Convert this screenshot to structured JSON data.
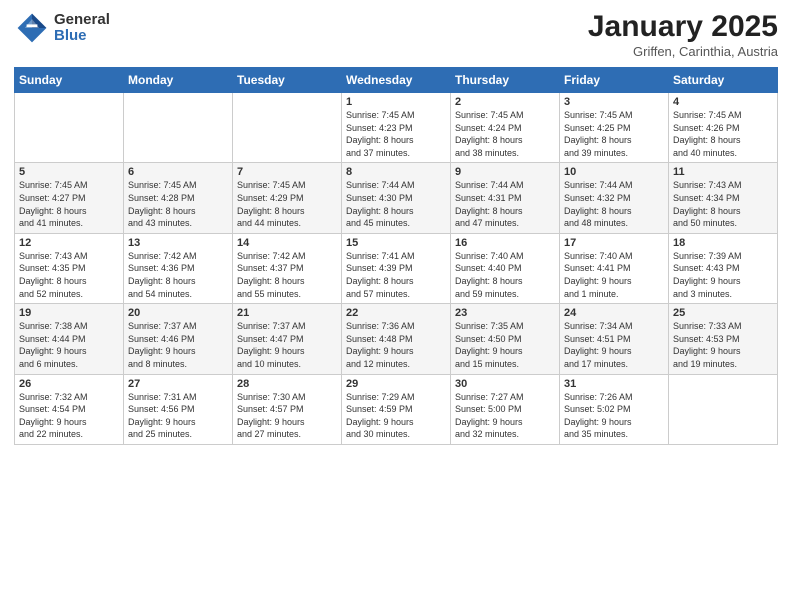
{
  "logo": {
    "general": "General",
    "blue": "Blue"
  },
  "title": "January 2025",
  "subtitle": "Griffen, Carinthia, Austria",
  "days": [
    "Sunday",
    "Monday",
    "Tuesday",
    "Wednesday",
    "Thursday",
    "Friday",
    "Saturday"
  ],
  "weeks": [
    [
      {
        "num": "",
        "info": ""
      },
      {
        "num": "",
        "info": ""
      },
      {
        "num": "",
        "info": ""
      },
      {
        "num": "1",
        "info": "Sunrise: 7:45 AM\nSunset: 4:23 PM\nDaylight: 8 hours\nand 37 minutes."
      },
      {
        "num": "2",
        "info": "Sunrise: 7:45 AM\nSunset: 4:24 PM\nDaylight: 8 hours\nand 38 minutes."
      },
      {
        "num": "3",
        "info": "Sunrise: 7:45 AM\nSunset: 4:25 PM\nDaylight: 8 hours\nand 39 minutes."
      },
      {
        "num": "4",
        "info": "Sunrise: 7:45 AM\nSunset: 4:26 PM\nDaylight: 8 hours\nand 40 minutes."
      }
    ],
    [
      {
        "num": "5",
        "info": "Sunrise: 7:45 AM\nSunset: 4:27 PM\nDaylight: 8 hours\nand 41 minutes."
      },
      {
        "num": "6",
        "info": "Sunrise: 7:45 AM\nSunset: 4:28 PM\nDaylight: 8 hours\nand 43 minutes."
      },
      {
        "num": "7",
        "info": "Sunrise: 7:45 AM\nSunset: 4:29 PM\nDaylight: 8 hours\nand 44 minutes."
      },
      {
        "num": "8",
        "info": "Sunrise: 7:44 AM\nSunset: 4:30 PM\nDaylight: 8 hours\nand 45 minutes."
      },
      {
        "num": "9",
        "info": "Sunrise: 7:44 AM\nSunset: 4:31 PM\nDaylight: 8 hours\nand 47 minutes."
      },
      {
        "num": "10",
        "info": "Sunrise: 7:44 AM\nSunset: 4:32 PM\nDaylight: 8 hours\nand 48 minutes."
      },
      {
        "num": "11",
        "info": "Sunrise: 7:43 AM\nSunset: 4:34 PM\nDaylight: 8 hours\nand 50 minutes."
      }
    ],
    [
      {
        "num": "12",
        "info": "Sunrise: 7:43 AM\nSunset: 4:35 PM\nDaylight: 8 hours\nand 52 minutes."
      },
      {
        "num": "13",
        "info": "Sunrise: 7:42 AM\nSunset: 4:36 PM\nDaylight: 8 hours\nand 54 minutes."
      },
      {
        "num": "14",
        "info": "Sunrise: 7:42 AM\nSunset: 4:37 PM\nDaylight: 8 hours\nand 55 minutes."
      },
      {
        "num": "15",
        "info": "Sunrise: 7:41 AM\nSunset: 4:39 PM\nDaylight: 8 hours\nand 57 minutes."
      },
      {
        "num": "16",
        "info": "Sunrise: 7:40 AM\nSunset: 4:40 PM\nDaylight: 8 hours\nand 59 minutes."
      },
      {
        "num": "17",
        "info": "Sunrise: 7:40 AM\nSunset: 4:41 PM\nDaylight: 9 hours\nand 1 minute."
      },
      {
        "num": "18",
        "info": "Sunrise: 7:39 AM\nSunset: 4:43 PM\nDaylight: 9 hours\nand 3 minutes."
      }
    ],
    [
      {
        "num": "19",
        "info": "Sunrise: 7:38 AM\nSunset: 4:44 PM\nDaylight: 9 hours\nand 6 minutes."
      },
      {
        "num": "20",
        "info": "Sunrise: 7:37 AM\nSunset: 4:46 PM\nDaylight: 9 hours\nand 8 minutes."
      },
      {
        "num": "21",
        "info": "Sunrise: 7:37 AM\nSunset: 4:47 PM\nDaylight: 9 hours\nand 10 minutes."
      },
      {
        "num": "22",
        "info": "Sunrise: 7:36 AM\nSunset: 4:48 PM\nDaylight: 9 hours\nand 12 minutes."
      },
      {
        "num": "23",
        "info": "Sunrise: 7:35 AM\nSunset: 4:50 PM\nDaylight: 9 hours\nand 15 minutes."
      },
      {
        "num": "24",
        "info": "Sunrise: 7:34 AM\nSunset: 4:51 PM\nDaylight: 9 hours\nand 17 minutes."
      },
      {
        "num": "25",
        "info": "Sunrise: 7:33 AM\nSunset: 4:53 PM\nDaylight: 9 hours\nand 19 minutes."
      }
    ],
    [
      {
        "num": "26",
        "info": "Sunrise: 7:32 AM\nSunset: 4:54 PM\nDaylight: 9 hours\nand 22 minutes."
      },
      {
        "num": "27",
        "info": "Sunrise: 7:31 AM\nSunset: 4:56 PM\nDaylight: 9 hours\nand 25 minutes."
      },
      {
        "num": "28",
        "info": "Sunrise: 7:30 AM\nSunset: 4:57 PM\nDaylight: 9 hours\nand 27 minutes."
      },
      {
        "num": "29",
        "info": "Sunrise: 7:29 AM\nSunset: 4:59 PM\nDaylight: 9 hours\nand 30 minutes."
      },
      {
        "num": "30",
        "info": "Sunrise: 7:27 AM\nSunset: 5:00 PM\nDaylight: 9 hours\nand 32 minutes."
      },
      {
        "num": "31",
        "info": "Sunrise: 7:26 AM\nSunset: 5:02 PM\nDaylight: 9 hours\nand 35 minutes."
      },
      {
        "num": "",
        "info": ""
      }
    ]
  ]
}
